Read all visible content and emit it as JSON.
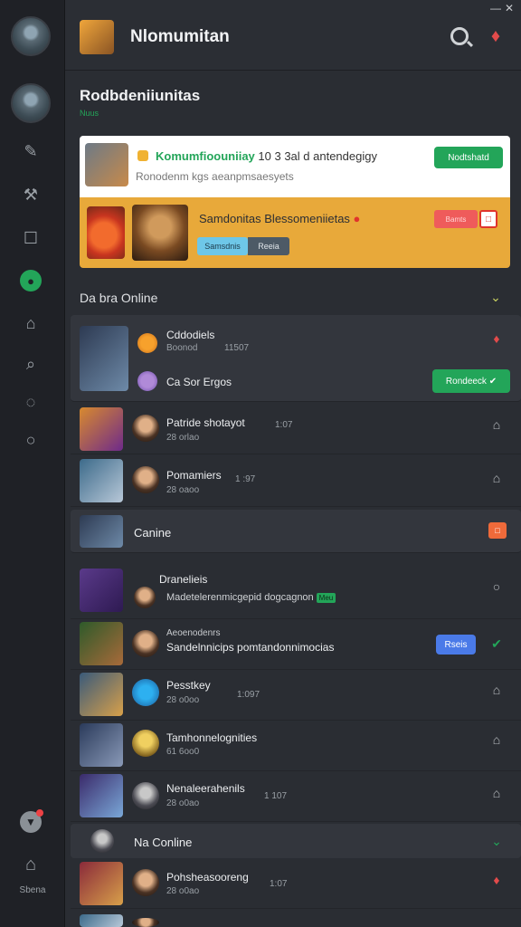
{
  "app": {
    "title": "Nlomumitan",
    "window_controls": {
      "minimize": "—",
      "close": "✕"
    }
  },
  "sidebar": {
    "items": [
      {
        "name": "user-avatar"
      },
      {
        "name": "server-avatar"
      },
      {
        "name": "nav-edit",
        "icon": "✎"
      },
      {
        "name": "nav-tool",
        "icon": "⚒"
      },
      {
        "name": "nav-square",
        "icon": "☐"
      },
      {
        "name": "nav-online",
        "icon": "●"
      },
      {
        "name": "nav-controller",
        "icon": "⌂"
      },
      {
        "name": "nav-search",
        "icon": "⌕"
      },
      {
        "name": "nav-chat",
        "icon": "◌"
      },
      {
        "name": "nav-circle",
        "icon": "○"
      }
    ],
    "bottom_label": "Sbena"
  },
  "header": {
    "heading": "Rodbdeniiunitas",
    "subheading": "Nuus"
  },
  "featured": {
    "top": {
      "title_green": "Komumfioouniiay",
      "title_rest": "10 3 3al d antendegigy",
      "subtitle": "Ronodenm kgs aeanpmsaesyets",
      "button": "Nodtshatd"
    },
    "bottom": {
      "title": "Samdonitas Blessomeniietas",
      "pin": "●",
      "pill1": "Samsdnis",
      "pill2": "Reeia",
      "red_button": "Bamts",
      "red_square": "□"
    }
  },
  "sections": [
    {
      "label": "Da bra Online",
      "chevron": "⌄"
    },
    {
      "label": "Canine"
    },
    {
      "label": "Na Conline",
      "chevron": "⌄"
    }
  ],
  "rows": [
    {
      "name": "Cddodiels",
      "status": "Boonod",
      "count": "11507",
      "action": "♦"
    },
    {
      "name": "Ca Sor Ergos",
      "button": "Rondeeck ✔"
    },
    {
      "name": "Patride shotayot",
      "status": "28 orlao",
      "count": "1:07",
      "action": "⌂"
    },
    {
      "name": "Pomamiers",
      "status": "28 oaoo",
      "count": "1 :97",
      "action": "⌂"
    },
    {
      "name": "Canine",
      "action": "□"
    },
    {
      "name": "Dranelieis",
      "status": "Madetelerenmicgepid dogcagnon",
      "badge": "Meu",
      "action": "○"
    },
    {
      "name": "Aeoenodenrs",
      "status": "Sandelnnicips pomtandonnimocias",
      "button": "Rseis",
      "action": "✔"
    },
    {
      "name": "Pesstkey",
      "status": "28 o0oo",
      "count": "1:097",
      "action": "⌂"
    },
    {
      "name": "Tamhonnelognities",
      "status": "61 6oo0",
      "action": "⌂"
    },
    {
      "name": "Nenaleerahenils",
      "status": "28 o0ao",
      "count": "1 107",
      "action": "⌂"
    },
    {
      "name": "Pohsheasooreng",
      "status": "28 o0ao",
      "count": "1:07",
      "action": "♦"
    }
  ],
  "colors": {
    "accent_green": "#23a559",
    "accent_orange": "#e8a93a",
    "danger": "#e24b4b",
    "background": "#2a2d33"
  }
}
